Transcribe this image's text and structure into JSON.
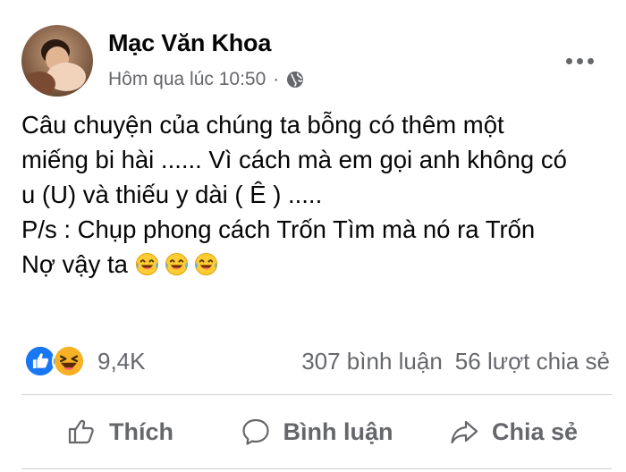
{
  "post": {
    "author": "Mạc Văn Khoa",
    "timestamp": "Hôm qua lúc 10:50",
    "separator": "·",
    "privacy_icon": "globe-icon",
    "more_icon": "more-options-icon",
    "content_lines": [
      "Câu chuyện của chúng ta bỗng có thêm một",
      "miếng bi hài ...... Vì cách mà em gọi anh không có",
      "u (U) và thiếu y dài ( Ê ) .....",
      "P/s : Chụp phong cách Trốn Tìm mà nó ra Trốn",
      "Nợ vậy ta"
    ],
    "trailing_emojis": [
      "laughing-tears-emoji",
      "laughing-tears-emoji",
      "laughing-tears-emoji"
    ]
  },
  "reactions": {
    "icons": [
      "like-reaction-icon",
      "haha-reaction-icon"
    ],
    "count": "9,4K",
    "comments": "307 bình luận",
    "shares": "56 lượt chia sẻ"
  },
  "actions": {
    "like_label": "Thích",
    "comment_label": "Bình luận",
    "share_label": "Chia sẻ"
  },
  "colors": {
    "text_primary": "#050505",
    "text_secondary": "#65676b",
    "divider": "#ced0d4",
    "like_blue": "#1877f2",
    "haha_yellow": "#f7b125"
  }
}
